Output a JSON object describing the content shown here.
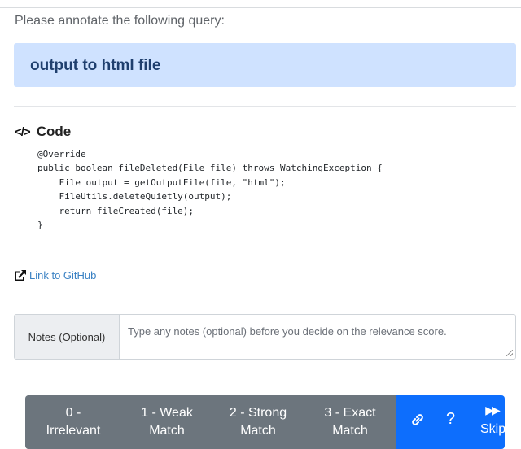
{
  "prompt": "Please annotate the following query:",
  "query": "output to html file",
  "code": {
    "icon": "code-brackets-icon",
    "icon_glyph": "</>",
    "title": "Code",
    "snippet": "@Override\npublic boolean fileDeleted(File file) throws WatchingException {\n    File output = getOutputFile(file, \"html\");\n    FileUtils.deleteQuietly(output);\n    return fileCreated(file);\n}"
  },
  "github_link": {
    "icon": "external-link-icon",
    "label": "Link to GitHub"
  },
  "notes": {
    "label": "Notes (Optional)",
    "placeholder": "Type any notes (optional) before you decide on the relevance score."
  },
  "scores": [
    {
      "label": "0 -\nIrrelevant"
    },
    {
      "label": "1 - Weak\nMatch"
    },
    {
      "label": "2 - Strong\nMatch"
    },
    {
      "label": "3 - Exact\nMatch"
    }
  ],
  "actions": {
    "link_icon": "link-icon",
    "help_glyph": "?",
    "help_icon": "help-icon",
    "skip_icon": "fast-forward-icon",
    "skip_glyph": "▶▶",
    "skip_label": "Skip"
  },
  "colors": {
    "query_bg": "#cfe2ff",
    "query_text": "#1f3f6e",
    "score_btn": "#6c757d",
    "primary": "#0d6efd",
    "link": "#3b82c4"
  }
}
